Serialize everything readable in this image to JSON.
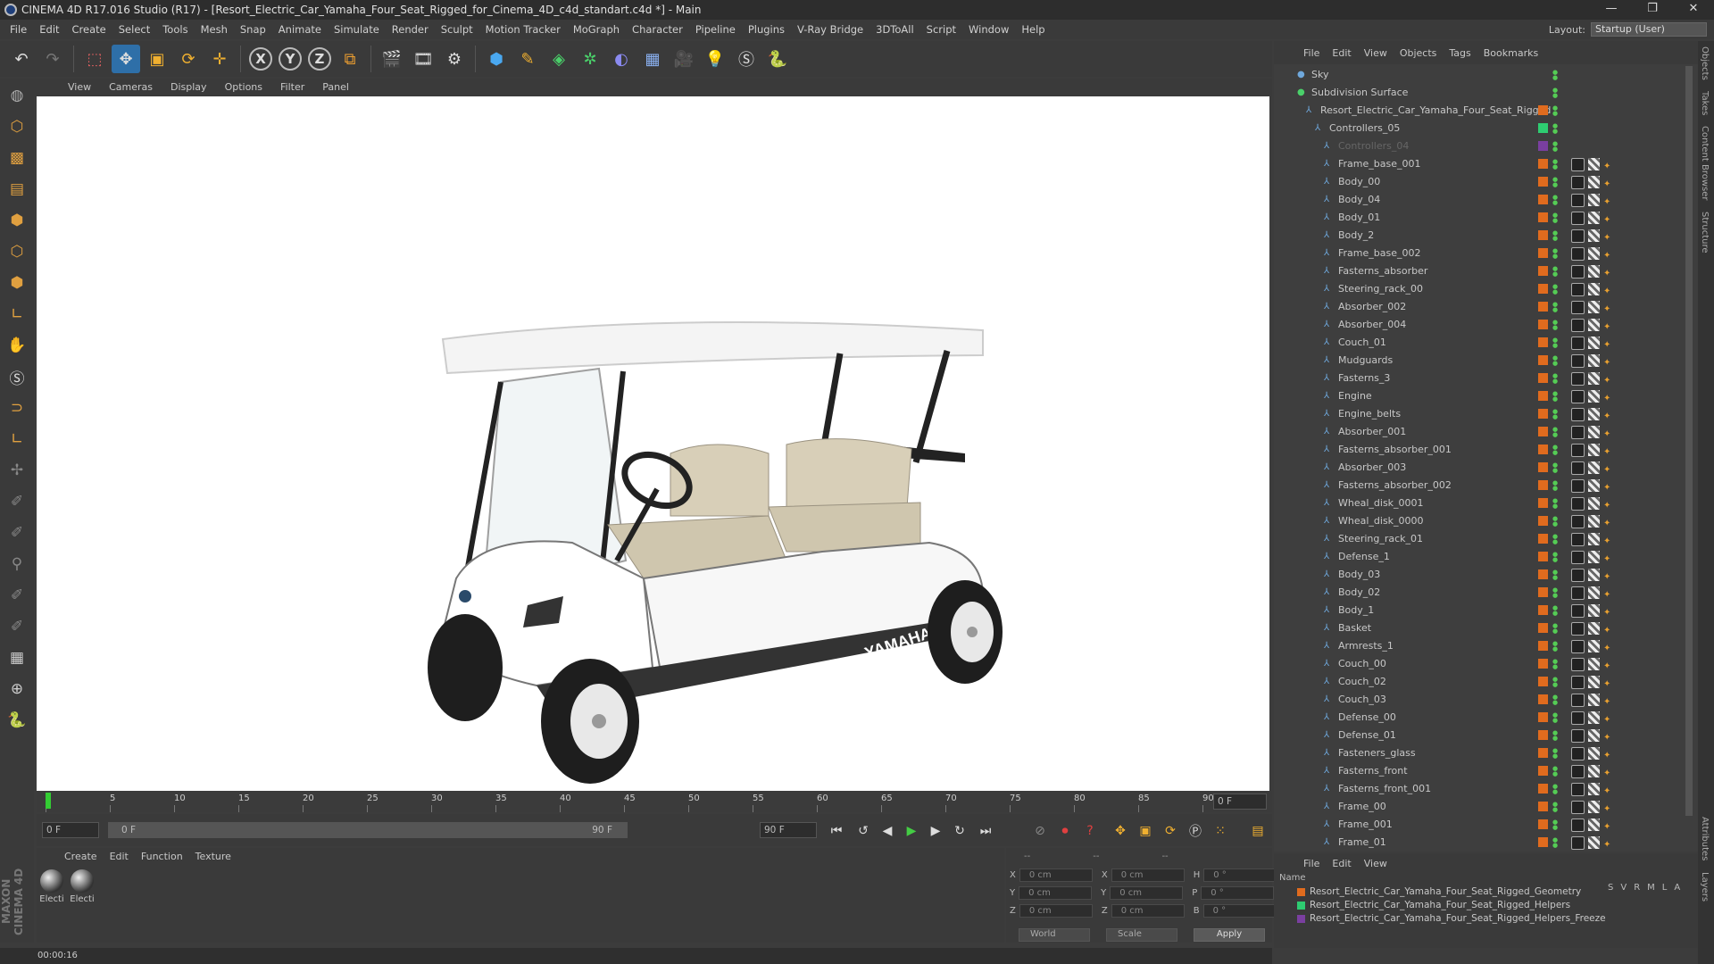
{
  "window": {
    "title": "CINEMA 4D R17.016 Studio (R17) - [Resort_Electric_Car_Yamaha_Four_Seat_Rigged_for_Cinema_4D_c4d_standart.c4d *] - Main",
    "minimize": "—",
    "maximize": "❐",
    "close": "✕"
  },
  "menu": [
    "File",
    "Edit",
    "Create",
    "Select",
    "Tools",
    "Mesh",
    "Snap",
    "Animate",
    "Simulate",
    "Render",
    "Sculpt",
    "Motion Tracker",
    "MoGraph",
    "Character",
    "Pipeline",
    "Plugins",
    "V-Ray Bridge",
    "3DToAll",
    "Script",
    "Window",
    "Help"
  ],
  "layout": {
    "label": "Layout:",
    "value": "Startup (User)"
  },
  "viewport_menu": [
    "View",
    "Cameras",
    "Display",
    "Options",
    "Filter",
    "Panel"
  ],
  "timeline": {
    "ticks": [
      "0",
      "5",
      "10",
      "15",
      "20",
      "25",
      "30",
      "35",
      "40",
      "45",
      "50",
      "55",
      "60",
      "65",
      "70",
      "75",
      "80",
      "85",
      "90"
    ],
    "end_field": "0 F"
  },
  "playback": {
    "start": "0 F",
    "slider_start": "0 F",
    "slider_end": "90 F",
    "end": "90 F"
  },
  "material_menu": [
    "Create",
    "Edit",
    "Function",
    "Texture"
  ],
  "materials": [
    {
      "label": "Electi"
    },
    {
      "label": "Electi"
    }
  ],
  "coords": {
    "header": [
      "--",
      "--",
      "--"
    ],
    "rows": [
      {
        "a": "X",
        "v1": "0 cm",
        "b": "X",
        "v2": "0 cm",
        "c": "H",
        "v3": "0 °"
      },
      {
        "a": "Y",
        "v1": "0 cm",
        "b": "Y",
        "v2": "0 cm",
        "c": "P",
        "v3": "0 °"
      },
      {
        "a": "Z",
        "v1": "0 cm",
        "b": "Z",
        "v2": "0 cm",
        "c": "B",
        "v3": "0 °"
      }
    ],
    "world": "World",
    "scale": "Scale",
    "apply": "Apply"
  },
  "status": {
    "time": "00:00:16"
  },
  "object_menu": [
    "File",
    "Edit",
    "View",
    "Objects",
    "Tags",
    "Bookmarks"
  ],
  "objects": [
    {
      "name": "Sky",
      "indent": 0
    },
    {
      "name": "Subdivision Surface",
      "indent": 0
    },
    {
      "name": "Resort_Electric_Car_Yamaha_Four_Seat_Rigged",
      "indent": 1
    },
    {
      "name": "Controllers_05",
      "indent": 2
    },
    {
      "name": "Controllers_04",
      "indent": 3
    },
    {
      "name": "Frame_base_001",
      "indent": 3
    },
    {
      "name": "Body_00",
      "indent": 3
    },
    {
      "name": "Body_04",
      "indent": 3
    },
    {
      "name": "Body_01",
      "indent": 3
    },
    {
      "name": "Body_2",
      "indent": 3
    },
    {
      "name": "Frame_base_002",
      "indent": 3
    },
    {
      "name": "Fasterns_absorber",
      "indent": 3
    },
    {
      "name": "Steering_rack_00",
      "indent": 3
    },
    {
      "name": "Absorber_002",
      "indent": 3
    },
    {
      "name": "Absorber_004",
      "indent": 3
    },
    {
      "name": "Couch_01",
      "indent": 3
    },
    {
      "name": "Mudguards",
      "indent": 3
    },
    {
      "name": "Fasterns_3",
      "indent": 3
    },
    {
      "name": "Engine",
      "indent": 3
    },
    {
      "name": "Engine_belts",
      "indent": 3
    },
    {
      "name": "Absorber_001",
      "indent": 3
    },
    {
      "name": "Fasterns_absorber_001",
      "indent": 3
    },
    {
      "name": "Absorber_003",
      "indent": 3
    },
    {
      "name": "Fasterns_absorber_002",
      "indent": 3
    },
    {
      "name": "Wheal_disk_0001",
      "indent": 3
    },
    {
      "name": "Wheal_disk_0000",
      "indent": 3
    },
    {
      "name": "Steering_rack_01",
      "indent": 3
    },
    {
      "name": "Defense_1",
      "indent": 3
    },
    {
      "name": "Body_03",
      "indent": 3
    },
    {
      "name": "Body_02",
      "indent": 3
    },
    {
      "name": "Body_1",
      "indent": 3
    },
    {
      "name": "Basket",
      "indent": 3
    },
    {
      "name": "Armrests_1",
      "indent": 3
    },
    {
      "name": "Couch_00",
      "indent": 3
    },
    {
      "name": "Couch_02",
      "indent": 3
    },
    {
      "name": "Couch_03",
      "indent": 3
    },
    {
      "name": "Defense_00",
      "indent": 3
    },
    {
      "name": "Defense_01",
      "indent": 3
    },
    {
      "name": "Fasteners_glass",
      "indent": 3
    },
    {
      "name": "Fasterns_front",
      "indent": 3
    },
    {
      "name": "Fasterns_front_001",
      "indent": 3
    },
    {
      "name": "Frame_00",
      "indent": 3
    },
    {
      "name": "Frame_001",
      "indent": 3
    },
    {
      "name": "Frame_01",
      "indent": 3
    }
  ],
  "layer_menu": [
    "File",
    "Edit",
    "View"
  ],
  "layer_header": {
    "name": "Name",
    "cols": [
      "S",
      "V",
      "R",
      "M",
      "L",
      "A"
    ]
  },
  "layers": [
    {
      "name": "Resort_Electric_Car_Yamaha_Four_Seat_Rigged_Geometry",
      "color": "#e06b1e"
    },
    {
      "name": "Resort_Electric_Car_Yamaha_Four_Seat_Rigged_Helpers",
      "color": "#2ecc71"
    },
    {
      "name": "Resort_Electric_Car_Yamaha_Four_Seat_Rigged_Helpers_Freeze",
      "color": "#7a3fa0"
    }
  ],
  "right_tabs": [
    "Objects",
    "Takes",
    "Content Browser",
    "Structure",
    "Attributes",
    "Layers"
  ],
  "brand": "MAXON CINEMA 4D",
  "car_logo": "YAMAHA"
}
